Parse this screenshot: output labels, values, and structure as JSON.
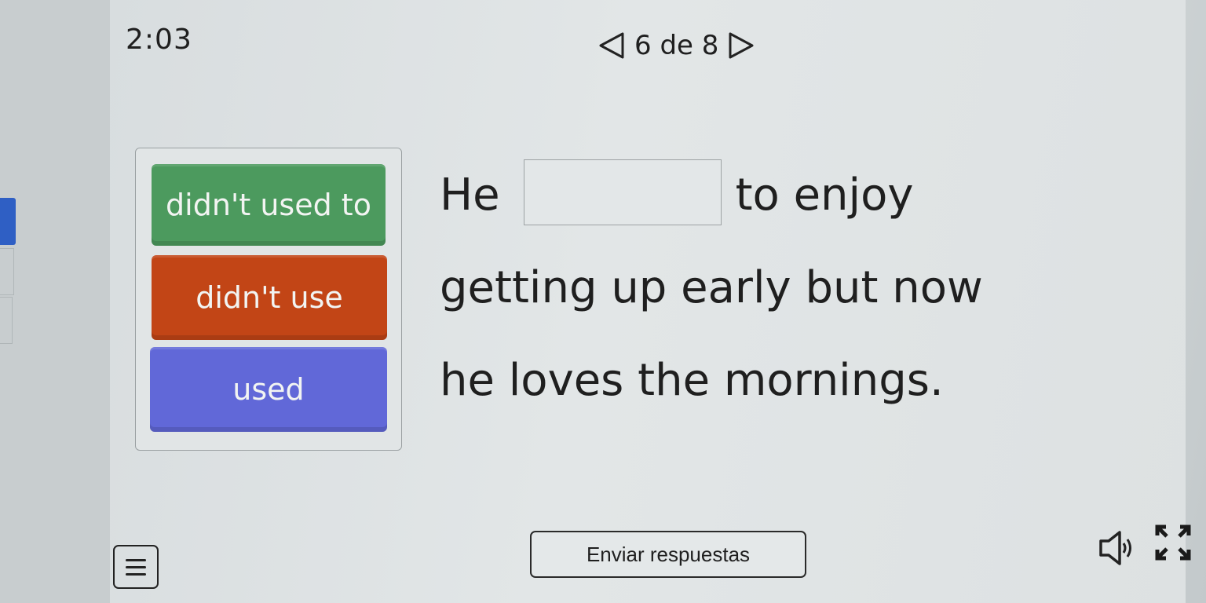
{
  "header": {
    "timer": "2:03",
    "page_indicator": "6 de 8",
    "prev_icon": "triangle-left-icon",
    "next_icon": "triangle-right-icon"
  },
  "choices": [
    {
      "label": "didn't used to",
      "color": "#4c9a5e"
    },
    {
      "label": "didn't use",
      "color": "#c24516"
    },
    {
      "label": "used",
      "color": "#6168d8"
    }
  ],
  "sentence": {
    "before_blank": "He",
    "after_blank": "to enjoy",
    "line2": "getting up early but now",
    "line3": "he loves the mornings.",
    "blank_value": ""
  },
  "footer": {
    "menu_icon": "hamburger-menu-icon",
    "submit_label": "Enviar respuestas",
    "audio_icon": "speaker-icon",
    "fullscreen_icon": "fullscreen-icon"
  }
}
